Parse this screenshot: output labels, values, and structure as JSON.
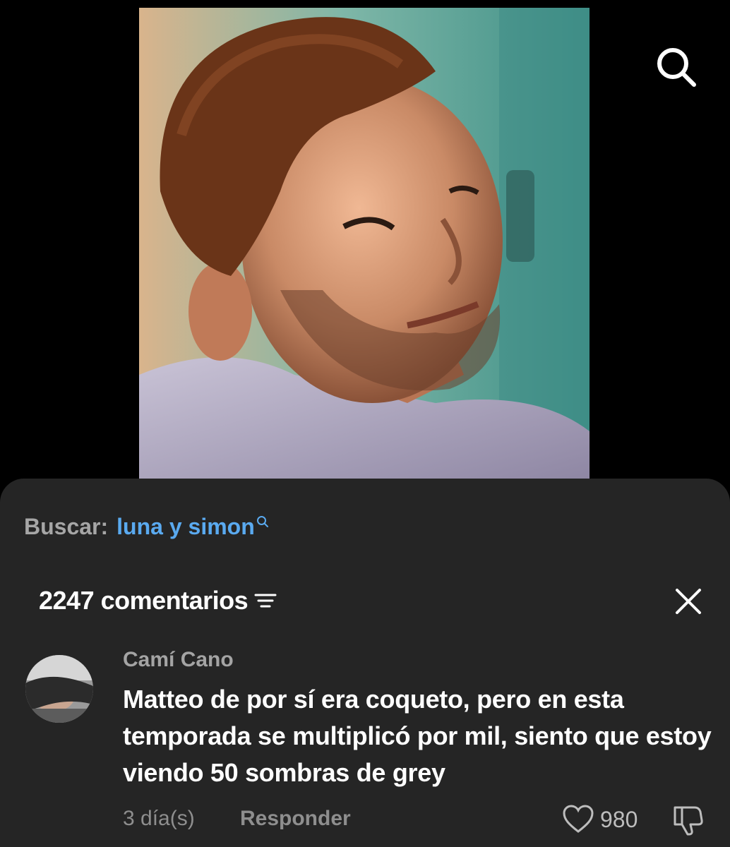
{
  "video": {
    "icon": "search-icon"
  },
  "search_suggestion": {
    "label": "Buscar:",
    "term": "luna y simon",
    "icon": "search-icon"
  },
  "comments": {
    "count_label": "2247 comentarios",
    "sort_icon": "sort-icon",
    "close_icon": "close-icon",
    "items": [
      {
        "author": "Camí Cano",
        "text": "Matteo de por sí era coqueto, pero en esta temporada se multiplicó por mil, siento que estoy viendo 50 sombras de grey",
        "time": "3 día(s)",
        "reply_label": "Responder",
        "likes": "980"
      }
    ]
  },
  "colors": {
    "sheet_bg": "#252525",
    "accent_link": "#5aaaf0",
    "muted_text": "#a4a4a4"
  }
}
